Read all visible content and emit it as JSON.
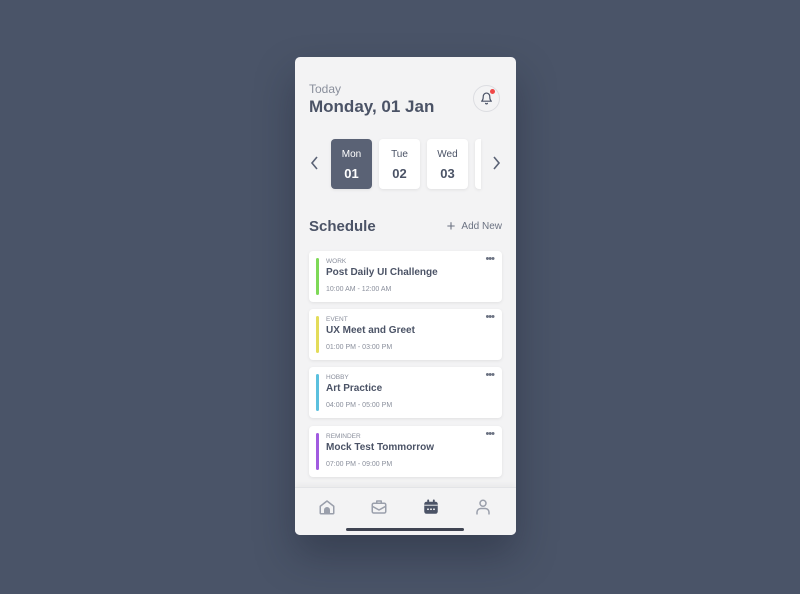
{
  "header": {
    "subtitle": "Today",
    "date": "Monday, 01 Jan",
    "notification_icon": "bell-icon",
    "has_unread": true
  },
  "calendar_strip": {
    "prev_icon": "chevron-left-icon",
    "next_icon": "chevron-right-icon",
    "days": [
      {
        "name": "Mon",
        "num": "01",
        "selected": true
      },
      {
        "name": "Tue",
        "num": "02",
        "selected": false
      },
      {
        "name": "Wed",
        "num": "03",
        "selected": false
      }
    ]
  },
  "schedule": {
    "title": "Schedule",
    "add_label": "Add New",
    "add_icon": "plus-icon",
    "items": [
      {
        "category": "WORK",
        "title": "Post Daily UI Challenge",
        "time": "10:00 AM - 12:00 AM",
        "color": "#7ed957"
      },
      {
        "category": "EVENT",
        "title": "UX Meet and Greet",
        "time": "01:00 PM - 03:00 PM",
        "color": "#e3dc5a"
      },
      {
        "category": "HOBBY",
        "title": "Art Practice",
        "time": "04:00 PM - 05:00 PM",
        "color": "#5bc0de"
      },
      {
        "category": "REMINDER",
        "title": "Mock Test Tommorrow",
        "time": "07:00 PM - 09:00 PM",
        "color": "#a15be0"
      }
    ],
    "more_label": "•••"
  },
  "bottom_nav": {
    "items": [
      "home-icon",
      "briefcase-icon",
      "calendar-icon",
      "user-icon"
    ],
    "active": "calendar-icon"
  },
  "colors": {
    "background": "#4a5468",
    "accent": "#5a6275",
    "text": "#4b5366"
  }
}
